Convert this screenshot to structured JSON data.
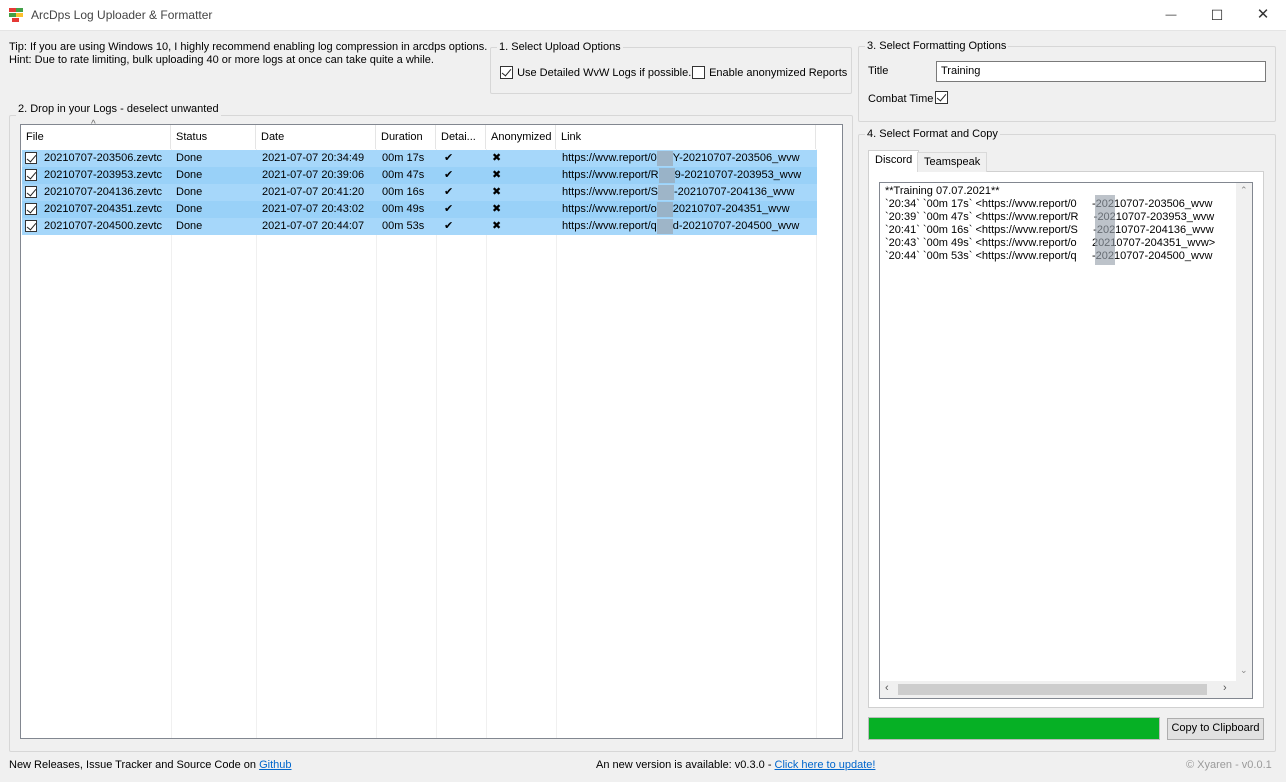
{
  "window": {
    "title": "ArcDps Log Uploader & Formatter",
    "minimize_glyph": "—",
    "maximize_glyph": "☐",
    "close_glyph": "✕"
  },
  "tips": {
    "tip": "Tip: If you are using Windows 10, I highly recommend enabling log compression in arcdps options.",
    "hint": "Hint: Due to rate limiting, bulk uploading 40 or more logs at once can take quite a while."
  },
  "upload_options": {
    "legend": "1. Select Upload Options",
    "detailed_wvw": {
      "label": "Use Detailed WvW Logs if possible.",
      "checked": true
    },
    "anonymized": {
      "label": "Enable anonymized Reports",
      "checked": false
    }
  },
  "logs": {
    "legend": "2. Drop in your Logs - deselect unwanted",
    "sort_indicator": "^",
    "columns": [
      "File",
      "Status",
      "Date",
      "Duration",
      "Detai...",
      "Anonymized",
      "Link"
    ],
    "rows": [
      {
        "file": "20210707-203506.zevtc",
        "status": "Done",
        "date": "2021-07-07 20:34:49",
        "duration": "00m 17s",
        "detailed": "✔",
        "anonymized": "✖",
        "link_prefix": "https://wvw.report/0",
        "link_suffix": "Y-20210707-203506_wvw",
        "checked": true
      },
      {
        "file": "20210707-203953.zevtc",
        "status": "Done",
        "date": "2021-07-07 20:39:06",
        "duration": "00m 47s",
        "detailed": "✔",
        "anonymized": "✖",
        "link_prefix": "https://wvw.report/R",
        "link_suffix": "9-20210707-203953_wvw",
        "checked": true
      },
      {
        "file": "20210707-204136.zevtc",
        "status": "Done",
        "date": "2021-07-07 20:41:20",
        "duration": "00m 16s",
        "detailed": "✔",
        "anonymized": "✖",
        "link_prefix": "https://wvw.report/S",
        "link_suffix": "-20210707-204136_wvw",
        "checked": true
      },
      {
        "file": "20210707-204351.zevtc",
        "status": "Done",
        "date": "2021-07-07 20:43:02",
        "duration": "00m 49s",
        "detailed": "✔",
        "anonymized": "✖",
        "link_prefix": "https://wvw.report/o",
        "link_suffix": "20210707-204351_wvw",
        "checked": true
      },
      {
        "file": "20210707-204500.zevtc",
        "status": "Done",
        "date": "2021-07-07 20:44:07",
        "duration": "00m 53s",
        "detailed": "✔",
        "anonymized": "✖",
        "link_prefix": "https://wvw.report/q",
        "link_suffix": "d-20210707-204500_wvw",
        "checked": true
      }
    ]
  },
  "formatting": {
    "legend": "3. Select Formatting Options",
    "title_label": "Title",
    "title_value": "Training",
    "combat_time_label": "Combat Time",
    "combat_time_checked": true
  },
  "format_copy": {
    "legend": "4. Select Format and Copy",
    "tabs": [
      "Discord",
      "Teamspeak"
    ],
    "active_tab": "Discord",
    "output_lines": [
      "**Training 07.07.2021**",
      "`20:34` `00m 17s` <https://wvw.report/0     -20210707-203506_wvw",
      "`20:39` `00m 47s` <https://wvw.report/R     -20210707-203953_wvw",
      "`20:41` `00m 16s` <https://wvw.report/S     -20210707-204136_wvw",
      "`20:43` `00m 49s` <https://wvw.report/o     20210707-204351_wvw>",
      "`20:44` `00m 53s` <https://wvw.report/q     -20210707-204500_wvw"
    ],
    "progress": 1.0,
    "progress_color": "#06b025",
    "copy_button": "Copy to Clipboard"
  },
  "footer": {
    "releases_text": "New Releases, Issue Tracker and Source Code on ",
    "github_link": "Github",
    "update_text": "An new version is available: v0.3.0 - ",
    "update_link": "Click here to update!",
    "author": "© Xyaren - v0.0.1"
  }
}
